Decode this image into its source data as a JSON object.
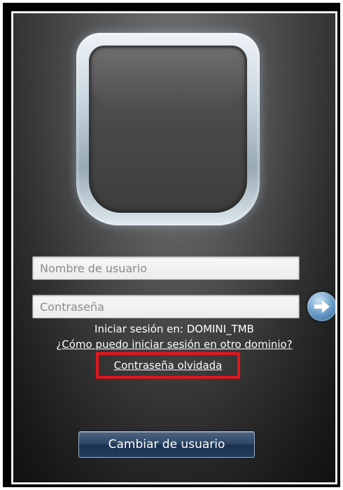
{
  "login": {
    "username_placeholder": "Nombre de usuario",
    "password_placeholder": "Contraseña",
    "signin_domain_text": "Iniciar sesión en: DOMINI_TMB",
    "other_domain_link": "¿Cómo puedo iniciar sesión en otro dominio?",
    "forgot_password_link": "Contraseña olvidada",
    "switch_user_button": "Cambiar de usuario",
    "submit_icon": "arrow-right-icon"
  },
  "colors": {
    "highlight_border": "#e3161c",
    "button_blue": "#2c4563",
    "arrow_button": "#6fa3cc"
  }
}
